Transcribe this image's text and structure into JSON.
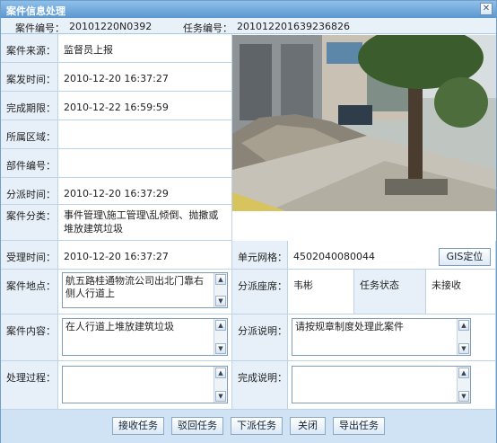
{
  "window": {
    "title": "案件信息处理"
  },
  "info": {
    "case_no_label": "案件编号：",
    "case_no": "20101220N0392",
    "task_no_label": "任务编号：",
    "task_no": "20101220163923682​6"
  },
  "fields": {
    "source_label": "案件来源：",
    "source": "监督员上报",
    "occur_label": "案发时间：",
    "occur": "2010-12-20 16:37:27",
    "deadline_label": "完成期限：",
    "deadline": "2010-12-22 16:59:59",
    "area_label": "所属区域：",
    "area": "",
    "part_label": "部件编号：",
    "part": "",
    "assign_time_label": "分派时间：",
    "assign_time": "2010-12-20 16:37:29",
    "category_label": "案件分类：",
    "category": "事件管理\\施工管理\\乱倾倒、抛撒或堆放建筑垃圾",
    "accept_label": "受理时间：",
    "accept": "2010-12-20 16:37:27",
    "grid_label": "单元网格：",
    "grid": "4502040080044",
    "gis_label": "GIS定位",
    "location_label": "案件地点：",
    "location": "航五路桂通物流公司出北门靠右侧人行道上",
    "seat_label": "分派座席：",
    "seat": "韦彬",
    "status_label": "任务状态",
    "status": "未接收",
    "content_label": "案件内容：",
    "content": "在人行道上堆放建筑垃圾",
    "assign_note_label": "分派说明：",
    "assign_note": "请按规章制度处理此案件",
    "process_label": "处理过程：",
    "process": "",
    "done_label": "完成说明：",
    "done": ""
  },
  "buttons": {
    "accept": "接收任务",
    "reject": "驳回任务",
    "dispatch": "下派任务",
    "close": "关闭",
    "export": "导出任务"
  }
}
